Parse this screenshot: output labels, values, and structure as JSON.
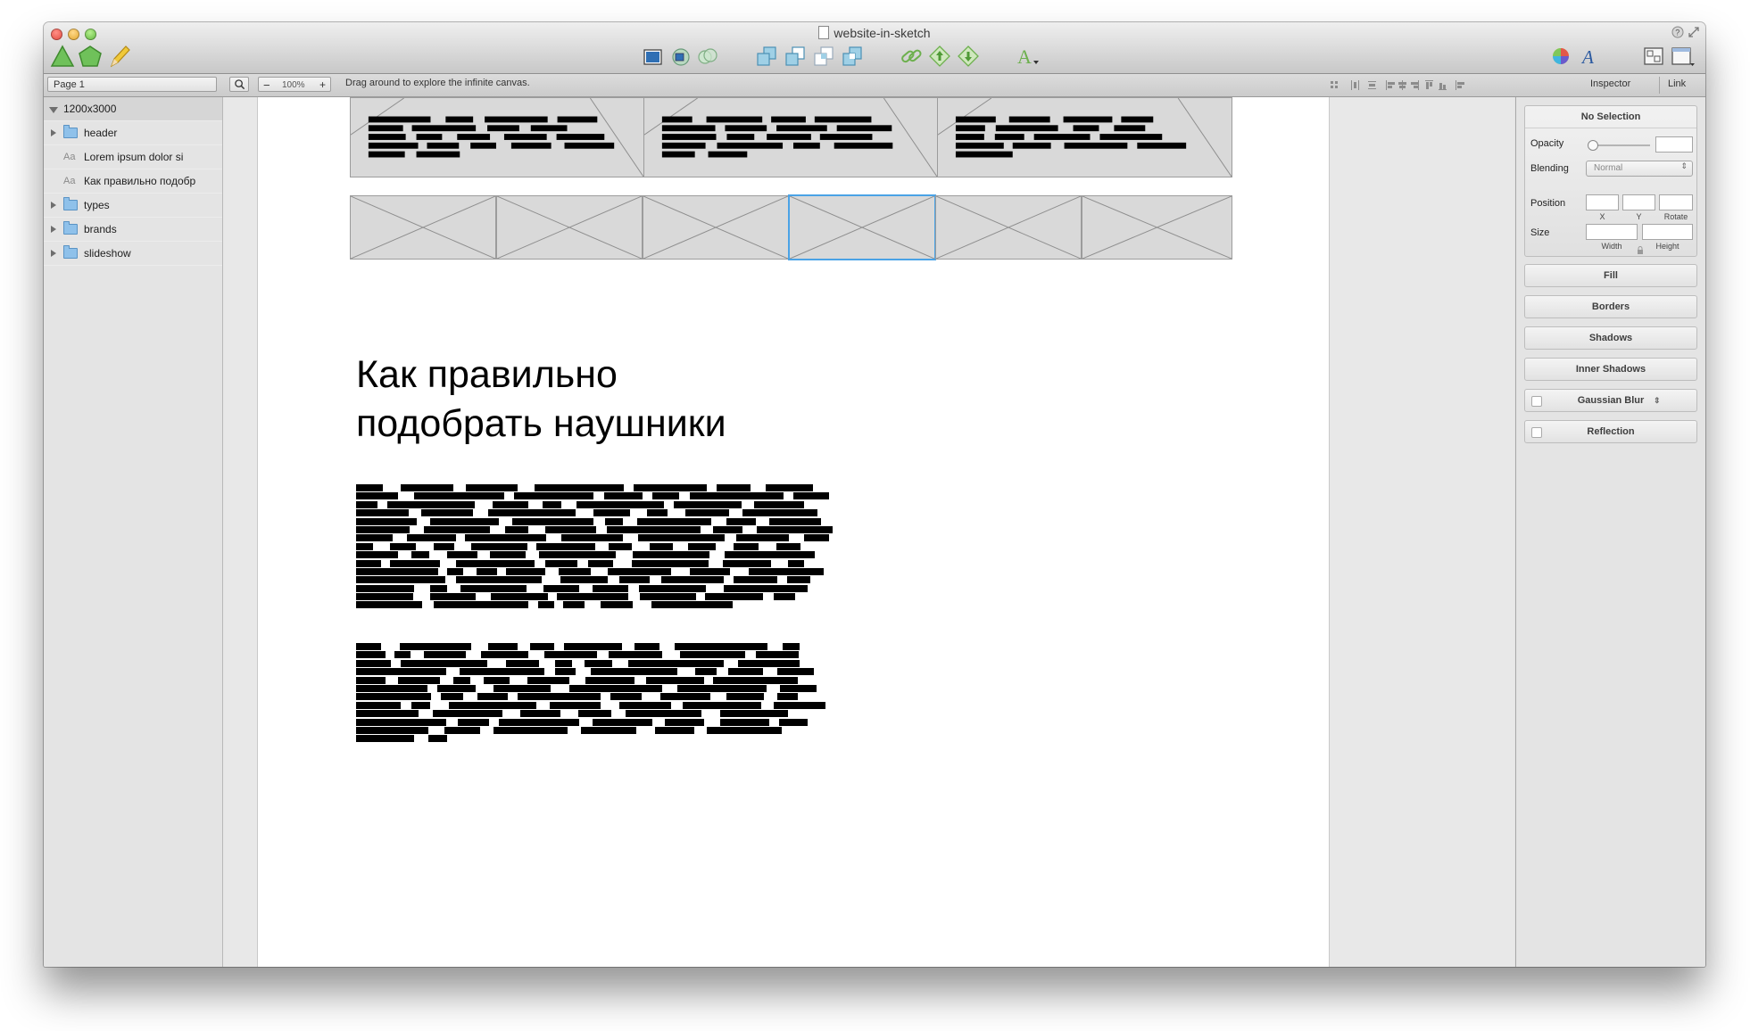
{
  "window": {
    "title": "website-in-sketch"
  },
  "toolbar": {
    "left_icons": [
      "triangle-shape-icon",
      "pentagon-shape-icon",
      "pencil-icon"
    ],
    "center_icons": [
      "image-icon",
      "mask-icon",
      "scissors-icon",
      "union-icon",
      "subtract-icon",
      "intersect-icon",
      "difference-icon",
      "link-icon",
      "forward-icon",
      "backward-icon",
      "text-style-icon"
    ],
    "right_icons": [
      "color-wheel-icon",
      "typography-icon",
      "view-icon",
      "window-icon"
    ]
  },
  "statusbar": {
    "page_select": "Page 1",
    "zoom_value": "100%",
    "zoom_out": "−",
    "zoom_in": "+",
    "hint": "Drag around to explore the infinite canvas.",
    "tabs": [
      "Inspector",
      "Link"
    ]
  },
  "layers": {
    "root": "1200x3000",
    "items": [
      {
        "label": "header",
        "kind": "folder"
      },
      {
        "label": "Lorem ipsum dolor si",
        "kind": "text",
        "icon_text": "Aa"
      },
      {
        "label": "Как правильно подобр",
        "kind": "text",
        "icon_text": "Aa"
      },
      {
        "label": "types",
        "kind": "folder"
      },
      {
        "label": "brands",
        "kind": "folder"
      },
      {
        "label": "slideshow",
        "kind": "folder"
      }
    ]
  },
  "canvas": {
    "article_title_line1": "Как правильно",
    "article_title_line2": "подобрать наушники"
  },
  "inspector": {
    "no_selection": "No Selection",
    "opacity_label": "Opacity",
    "blending_label": "Blending",
    "blending_value": "Normal",
    "position_label": "Position",
    "x_label": "X",
    "y_label": "Y",
    "rotate_label": "Rotate",
    "size_label": "Size",
    "width_label": "Width",
    "height_label": "Height",
    "fill": "Fill",
    "borders": "Borders",
    "shadows": "Shadows",
    "inner_shadows": "Inner Shadows",
    "gaussian_blur": "Gaussian Blur",
    "reflection": "Reflection"
  },
  "colors": {
    "selection": "#4aa3e6",
    "toolbar_green": "#5bb04a",
    "folder_blue": "#8fc1ea"
  }
}
